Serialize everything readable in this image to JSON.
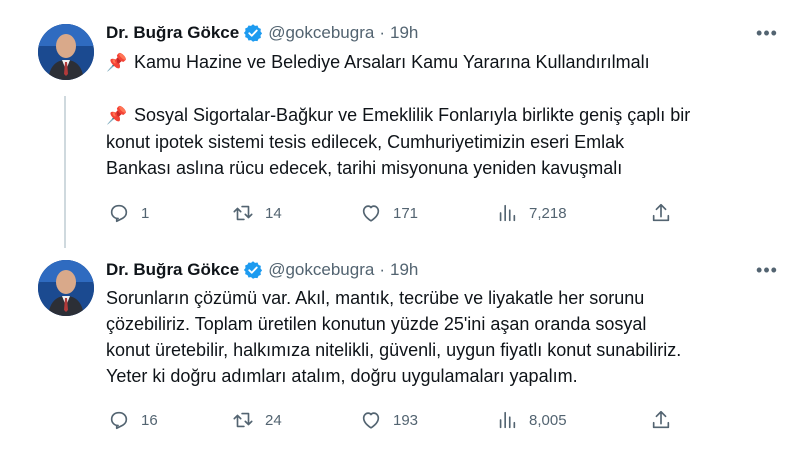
{
  "tweets": [
    {
      "author": {
        "name": "Dr. Buğra Gökce",
        "handle": "@gokcebugra",
        "verified": true
      },
      "separator": "·",
      "time": "19h",
      "paragraphs": [
        {
          "lines": [
            "Kamu Hazine ve Belediye Arsaları Kamu Yararına Kullandırılmalı"
          ],
          "pinned": true
        },
        {
          "lines": [
            "Sosyal Sigortalar-Bağkur ve Emeklilik Fonlarıyla birlikte geniş çaplı bir",
            "konut ipotek sistemi tesis edilecek, Cumhuriyetimizin eseri  Emlak",
            "Bankası aslına rücu edecek, tarihi misyonuna yeniden kavuşmalı"
          ],
          "pinned": true
        }
      ],
      "counts": {
        "replies": "1",
        "retweets": "14",
        "likes": "171",
        "views": "7,218"
      }
    },
    {
      "author": {
        "name": "Dr. Buğra Gökce",
        "handle": "@gokcebugra",
        "verified": true
      },
      "separator": "·",
      "time": "19h",
      "lines": [
        "Sorunların çözümü var. Akıl, mantık, tecrübe ve liyakatle her sorunu",
        "çözebiliriz. Toplam üretilen konutun yüzde 25'ini aşan oranda sosyal",
        "konut üretebilir, halkımıza nitelikli, güvenli, uygun fiyatlı konut sunabiliriz.",
        "Yeter ki doğru adımları atalım, doğru uygulamaları yapalım."
      ],
      "counts": {
        "replies": "16",
        "retweets": "24",
        "likes": "193",
        "views": "8,005"
      }
    }
  ],
  "icons": {
    "pin": "pushpin-icon",
    "verified": "verified-badge-icon",
    "more": "more-horizontal-icon",
    "reply": "reply-icon",
    "retweet": "retweet-icon",
    "like": "heart-icon",
    "views": "views-icon",
    "share": "share-icon"
  },
  "colors": {
    "verified": "#1d9bf0",
    "secondary_text": "#536471",
    "pin": "#e0245e",
    "thread_line": "#cfd9de"
  }
}
